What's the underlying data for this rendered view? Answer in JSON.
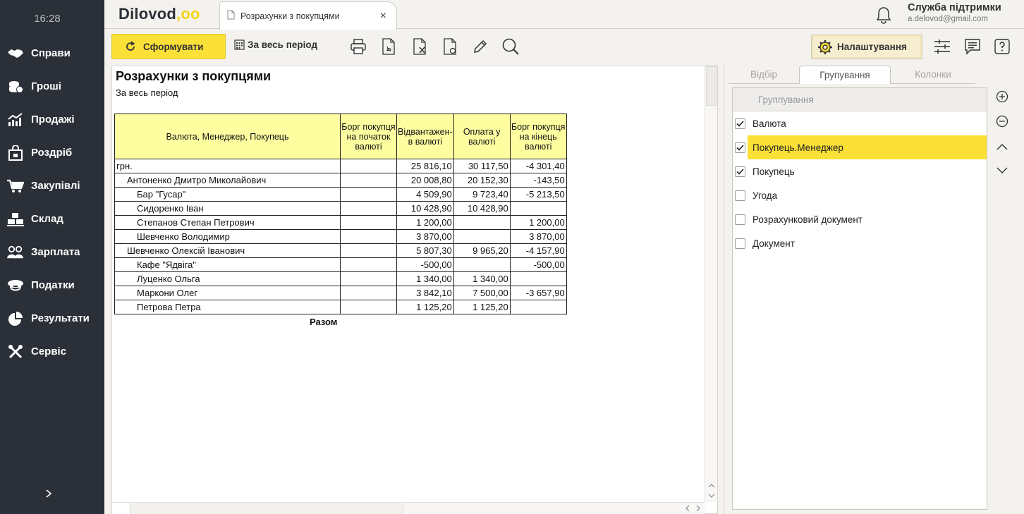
{
  "sidebar": {
    "time": "16:28",
    "items": [
      {
        "label": "Справи",
        "icon": "handshake-icon"
      },
      {
        "label": "Гроші",
        "icon": "coins-icon"
      },
      {
        "label": "Продажі",
        "icon": "chart-growth-icon"
      },
      {
        "label": "Роздріб",
        "icon": "shopping-bag-icon"
      },
      {
        "label": "Закупівлі",
        "icon": "cart-icon"
      },
      {
        "label": "Склад",
        "icon": "boxes-icon"
      },
      {
        "label": "Зарплата",
        "icon": "people-icon"
      },
      {
        "label": "Податки",
        "icon": "officer-cap-icon"
      },
      {
        "label": "Результати",
        "icon": "pie-chart-icon"
      },
      {
        "label": "Сервіс",
        "icon": "tools-icon"
      }
    ],
    "expand_icon": "chevron-right-icon"
  },
  "header": {
    "logo_text": "Dilovod",
    "logo_dots": ",oo",
    "tab_label": "Розрахунки з покупцями",
    "tab_close": "×",
    "support_title": "Служба підтримки",
    "support_email": "a.delovod@gmail.com"
  },
  "toolbar": {
    "generate_label": "Сформувати",
    "period_label": "За весь період",
    "settings_label": "Налаштування"
  },
  "report": {
    "title": "Розрахунки з покупцями",
    "subtitle": "За весь період",
    "columns": [
      "Валюта, Менеджер, Покупець",
      "Борг покупця на початок валюті",
      "Відвантажен- в валюті",
      "Оплата у валюті",
      "Борг покупця на кінець валюті"
    ],
    "rows": [
      {
        "name": "грн.",
        "level": 0,
        "start": "",
        "shipped": "25 816,10",
        "paid": "30 117,50",
        "end": "-4 301,40"
      },
      {
        "name": "Антоненко Дмитро Миколайович",
        "level": 1,
        "start": "",
        "shipped": "20 008,80",
        "paid": "20 152,30",
        "end": "-143,50"
      },
      {
        "name": "Бар \"Гусар\"",
        "level": 2,
        "start": "",
        "shipped": "4 509,90",
        "paid": "9 723,40",
        "end": "-5 213,50"
      },
      {
        "name": "Сидоренко Іван",
        "level": 2,
        "start": "",
        "shipped": "10 428,90",
        "paid": "10 428,90",
        "end": ""
      },
      {
        "name": "Степанов Степан Петрович",
        "level": 2,
        "start": "",
        "shipped": "1 200,00",
        "paid": "",
        "end": "1 200,00"
      },
      {
        "name": "Шевченко Володимир",
        "level": 2,
        "start": "",
        "shipped": "3 870,00",
        "paid": "",
        "end": "3 870,00"
      },
      {
        "name": "Шевченко Олексій Іванович",
        "level": 1,
        "start": "",
        "shipped": "5 807,30",
        "paid": "9 965,20",
        "end": "-4 157,90"
      },
      {
        "name": "Кафе \"Ядвіга\"",
        "level": 2,
        "start": "",
        "shipped": "-500,00",
        "paid": "",
        "end": "-500,00"
      },
      {
        "name": "Луценко Ольга",
        "level": 2,
        "start": "",
        "shipped": "1 340,00",
        "paid": "1 340,00",
        "end": ""
      },
      {
        "name": "Маркони Олег",
        "level": 2,
        "start": "",
        "shipped": "3 842,10",
        "paid": "7 500,00",
        "end": "-3 657,90"
      },
      {
        "name": "Петрова Петра",
        "level": 2,
        "start": "",
        "shipped": "1 125,20",
        "paid": "1 125,20",
        "end": ""
      }
    ],
    "total_label": "Разом"
  },
  "panel": {
    "tabs": [
      "Відбір",
      "Групування",
      "Колонки"
    ],
    "active_tab": "Групування",
    "grouping_header": "Группування",
    "grouping_items": [
      {
        "label": "Валюта",
        "checked": true,
        "selected": false
      },
      {
        "label": "Покупець.Менеджер",
        "checked": true,
        "selected": true
      },
      {
        "label": "Покупець",
        "checked": true,
        "selected": false
      },
      {
        "label": "Угода",
        "checked": false,
        "selected": false
      },
      {
        "label": "Розрахунковий документ",
        "checked": false,
        "selected": false
      },
      {
        "label": "Документ",
        "checked": false,
        "selected": false
      }
    ]
  },
  "colors": {
    "sidebar_bg": "#2b3038",
    "accent_yellow": "#fbe037",
    "table_header_bg": "#fefda0"
  }
}
